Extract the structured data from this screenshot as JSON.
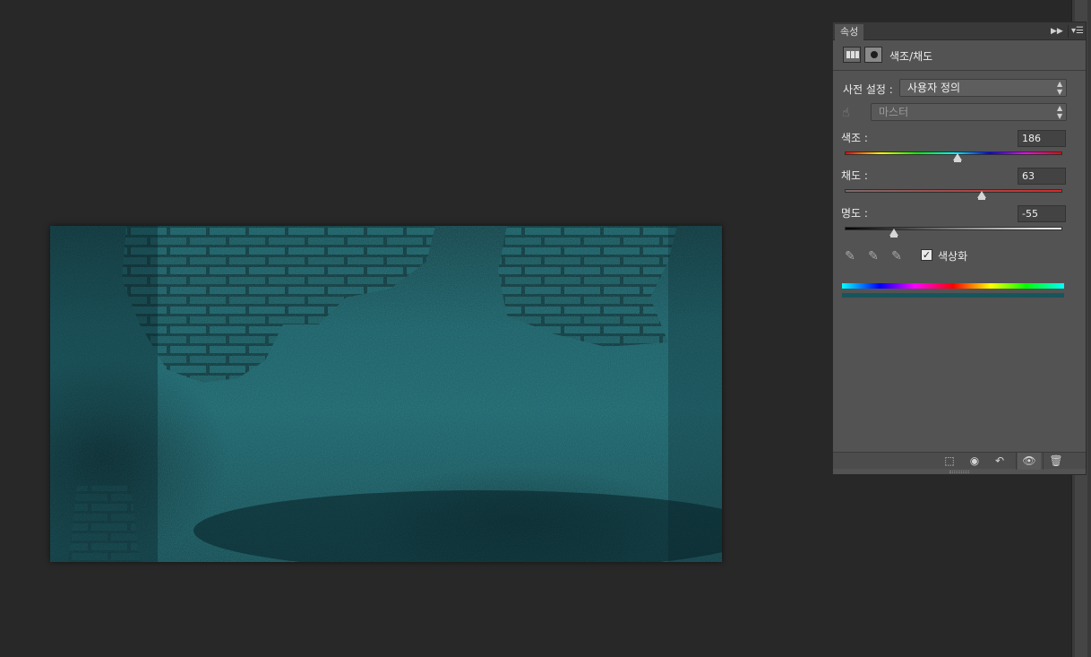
{
  "panel": {
    "tab_label": "속성",
    "title": "색조/채도",
    "preset_label": "사전 설정 :",
    "preset_value": "사용자 정의",
    "channel_value": "마스터",
    "colorize_label": "색상화",
    "colorize_checked": true
  },
  "hue": {
    "label": "색조 :",
    "value": "186",
    "fraction": 0.517
  },
  "saturation": {
    "label": "채도 :",
    "value": "63",
    "fraction": 0.63
  },
  "lightness": {
    "label": "명도 :",
    "value": "-55",
    "fraction": 0.225
  },
  "colors": {
    "canvas_bg": "#282828",
    "panel_bg": "#535353",
    "image_tint": "#1c6068",
    "colorize_swatch": "#17555c"
  },
  "icons": {
    "collapse": "double-chevron-right-icon",
    "menu": "panel-menu-icon",
    "adjustment": "hue-saturation-adjustment-icon",
    "mask": "layer-mask-icon",
    "hand": "targeted-adjustment-hand-icon",
    "eyedropper": "eyedropper-icon",
    "eyedropper_add": "eyedropper-add-icon",
    "eyedropper_subtract": "eyedropper-subtract-icon",
    "clip": "clip-to-layer-icon",
    "view_previous": "view-previous-state-icon",
    "reset": "reset-icon",
    "visibility": "eye-icon",
    "delete": "trash-icon"
  }
}
